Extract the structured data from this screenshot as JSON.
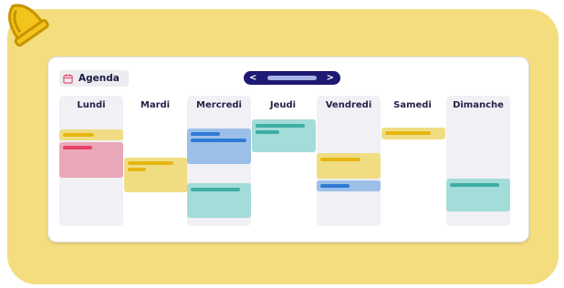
{
  "header": {
    "agenda_label": "Agenda",
    "prev_icon": "chevron-left-icon",
    "next_icon": "chevron-right-icon",
    "calendar_icon": "calendar-icon",
    "prev_glyph": "<",
    "next_glyph": ">"
  },
  "days": [
    "Lundi",
    "Mardi",
    "Mercredi",
    "Jeudi",
    "Vendredi",
    "Samedi",
    "Dimanche"
  ],
  "colors": {
    "background_blob": "#f4dd7e",
    "nav_pill": "#1e1a73",
    "event_yellow": "#f0dd83",
    "event_pink": "#e9a8b8",
    "event_blue": "#9cbfe8",
    "event_teal": "#a3dcd8"
  }
}
